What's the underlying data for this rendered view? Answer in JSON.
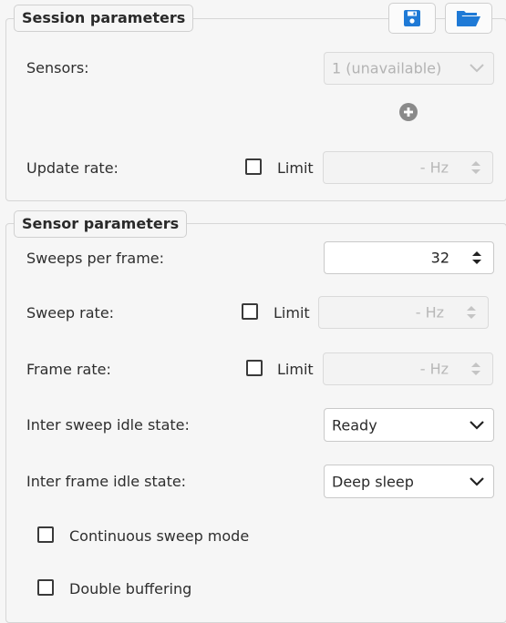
{
  "session": {
    "title": "Session parameters",
    "sensors_label": "Sensors:",
    "sensors_value": "1 (unavailable)",
    "update_rate_label": "Update rate:",
    "limit_label": "Limit",
    "update_rate_value": "- Hz",
    "save_icon": "save-icon",
    "open_icon": "folder-open-icon",
    "add_icon": "add-circle-icon"
  },
  "sensor": {
    "title": "Sensor parameters",
    "sweeps_per_frame_label": "Sweeps per frame:",
    "sweeps_per_frame_value": "32",
    "sweep_rate_label": "Sweep rate:",
    "sweep_rate_limit_label": "Limit",
    "sweep_rate_value": "- Hz",
    "frame_rate_label": "Frame rate:",
    "frame_rate_limit_label": "Limit",
    "frame_rate_value": "- Hz",
    "inter_sweep_label": "Inter sweep idle state:",
    "inter_sweep_value": "Ready",
    "inter_frame_label": "Inter frame idle state:",
    "inter_frame_value": "Deep sleep",
    "continuous_sweep_label": "Continuous sweep mode",
    "double_buffering_label": "Double buffering"
  },
  "colors": {
    "accent": "#1f7ad6",
    "add_icon": "#8a8a8a"
  }
}
